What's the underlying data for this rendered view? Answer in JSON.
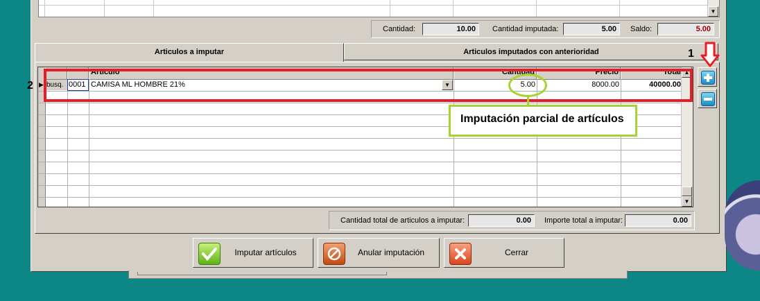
{
  "summary": {
    "cantidad_label": "Cantidad:",
    "cantidad_value": "10.00",
    "cantidad_imputada_label": "Cantidad imputada:",
    "cantidad_imputada_value": "5.00",
    "saldo_label": "Saldo:",
    "saldo_value": "5.00"
  },
  "tabs": [
    {
      "label": "Articulos a imputar",
      "active": true
    },
    {
      "label": "Articulos imputados con anterioridad",
      "active": false
    }
  ],
  "grid": {
    "columns": [
      "Articulo",
      "Cantidad",
      "Precio",
      "Total"
    ],
    "rows": [
      {
        "busq": "busq.",
        "codigo": "0001",
        "articulo": "CAMISA ML HOMBRE 21%",
        "cantidad": "5.00",
        "precio": "8000.00",
        "total": "40000.00"
      }
    ]
  },
  "totals": {
    "cantidad_total_label": "Cantidad total de articulos a imputar:",
    "cantidad_total_value": "0.00",
    "importe_total_label": "Importe total a imputar:",
    "importe_total_value": "0.00"
  },
  "buttons": {
    "imputar": "Imputar artículos",
    "anular": "Anular imputación",
    "cerrar": "Cerrar"
  },
  "annotations": {
    "num1": "1",
    "num2": "2",
    "callout": "Imputación parcial de artículos",
    "colors": {
      "red": "#e81c24",
      "green": "#a7d330"
    }
  },
  "icons": [
    "plus-icon",
    "minus-icon",
    "check-icon",
    "cancel-icon",
    "close-icon",
    "down-arrow-icon"
  ]
}
